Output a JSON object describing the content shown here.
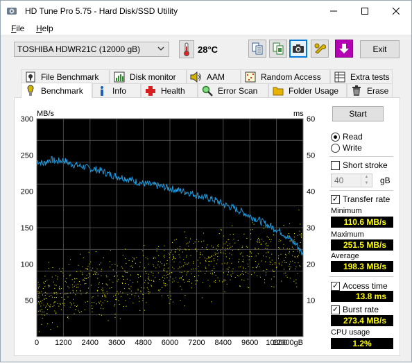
{
  "window": {
    "title": "HD Tune Pro 5.75 - Hard Disk/SSD Utility",
    "controls": [
      "minimize",
      "maximize",
      "close"
    ]
  },
  "menu": [
    {
      "label": "File",
      "accel": "F",
      "rest": "ile"
    },
    {
      "label": "Help",
      "accel": "H",
      "rest": "elp"
    }
  ],
  "toolbar": {
    "drive": "TOSHIBA HDWR21C (12000 gB)",
    "temperature": "28°C",
    "buttons": [
      {
        "name": "copy-text-button",
        "icon": "copy-text-icon"
      },
      {
        "name": "copy-info-button",
        "icon": "copy-info-icon"
      },
      {
        "name": "screenshot-button",
        "icon": "camera-icon",
        "active": true
      },
      {
        "name": "settings-button",
        "icon": "wrench-icon"
      },
      {
        "name": "save-button",
        "icon": "download-arrow-icon"
      }
    ],
    "exit_label": "Exit"
  },
  "tabs": {
    "row1": [
      {
        "label": "File Benchmark",
        "icon": "file-benchmark-icon"
      },
      {
        "label": "Disk monitor",
        "icon": "disk-monitor-icon"
      },
      {
        "label": "AAM",
        "icon": "speaker-icon"
      },
      {
        "label": "Random Access",
        "icon": "random-access-icon"
      },
      {
        "label": "Extra tests",
        "icon": "extra-tests-icon"
      }
    ],
    "row2": [
      {
        "label": "Benchmark",
        "icon": "benchmark-icon",
        "selected": true
      },
      {
        "label": "Info",
        "icon": "info-icon"
      },
      {
        "label": "Health",
        "icon": "health-cross-icon"
      },
      {
        "label": "Error Scan",
        "icon": "magnifier-icon"
      },
      {
        "label": "Folder Usage",
        "icon": "folder-icon"
      },
      {
        "label": "Erase",
        "icon": "trash-icon"
      }
    ]
  },
  "controls": {
    "start_label": "Start",
    "read_label": "Read",
    "write_label": "Write",
    "mode": "read",
    "short_stroke_label": "Short stroke",
    "short_stroke_checked": false,
    "short_stroke_value": "40",
    "short_stroke_unit": "gB",
    "transfer_rate_label": "Transfer rate",
    "transfer_rate_checked": true,
    "access_time_label": "Access time",
    "access_time_checked": true,
    "burst_rate_label": "Burst rate",
    "burst_rate_checked": true
  },
  "stats": {
    "minimum_label": "Minimum",
    "minimum": "110.6 MB/s",
    "maximum_label": "Maximum",
    "maximum": "251.5 MB/s",
    "average_label": "Average",
    "average": "198.3 MB/s",
    "access_time": "13.8 ms",
    "burst_rate": "273.4 MB/s",
    "cpu_usage_label": "CPU usage",
    "cpu_usage": "1.2%"
  },
  "chart_data": {
    "type": "line",
    "title": "",
    "ylabel": "MB/s",
    "y2label": "ms",
    "xlabel": "gB",
    "ylim": [
      0,
      300
    ],
    "y2lim": [
      0,
      60
    ],
    "xlim": [
      0,
      12000
    ],
    "yticks": [
      50,
      100,
      150,
      200,
      250,
      300
    ],
    "y2ticks": [
      10,
      20,
      30,
      40,
      50,
      60
    ],
    "xticks": [
      0,
      1200,
      2400,
      3600,
      4800,
      6000,
      7200,
      8400,
      9600,
      10800,
      12000
    ],
    "xtick_labels": [
      "0",
      "1200",
      "2400",
      "3600",
      "4800",
      "6000",
      "7200",
      "8400",
      "9600",
      "10800",
      "12000gB"
    ],
    "grid": true,
    "background": "#000000",
    "series": [
      {
        "name": "Transfer rate",
        "axis": "left",
        "color": "#1e9be0",
        "x": [
          0,
          300,
          600,
          900,
          1200,
          1500,
          1800,
          2100,
          2400,
          2700,
          3000,
          3300,
          3600,
          3900,
          4200,
          4500,
          4800,
          5100,
          5400,
          5700,
          6000,
          6300,
          6600,
          6900,
          7200,
          7500,
          7800,
          8100,
          8400,
          8700,
          9000,
          9300,
          9600,
          9900,
          10200,
          10500,
          10800,
          11100,
          11400,
          11700,
          12000
        ],
        "values": [
          242,
          238,
          244,
          241,
          243,
          238,
          236,
          234,
          231,
          230,
          227,
          223,
          221,
          219,
          216,
          213,
          211,
          209,
          208,
          206,
          204,
          202,
          200,
          198,
          195,
          192,
          190,
          187,
          182,
          179,
          175,
          171,
          166,
          162,
          157,
          152,
          148,
          142,
          134,
          127,
          112
        ]
      },
      {
        "name": "Access time",
        "axis": "right",
        "type": "scatter",
        "color": "#ffff00",
        "trend_x": [
          0,
          2400,
          4800,
          7200,
          9600,
          12000
        ],
        "trend_mean_ms": [
          10,
          14,
          17,
          20,
          22,
          24
        ],
        "spread_ms": [
          5,
          6,
          6,
          6,
          6,
          6
        ]
      }
    ]
  }
}
